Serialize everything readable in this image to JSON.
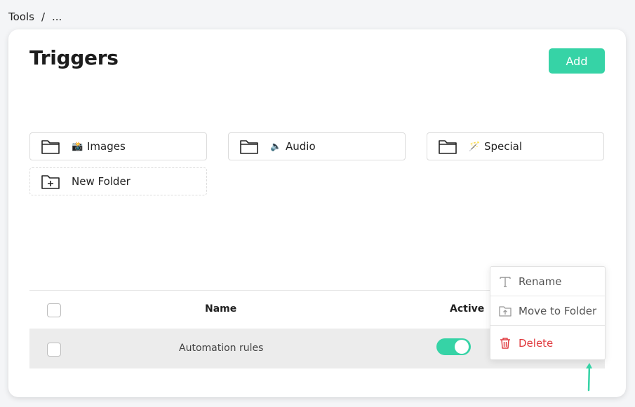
{
  "breadcrumb": {
    "root": "Tools",
    "separator": "/",
    "current": "..."
  },
  "page": {
    "title": "Triggers",
    "add_label": "Add"
  },
  "folders": [
    {
      "emoji": "📸",
      "label": "Images"
    },
    {
      "emoji": "🔈",
      "label": "Audio"
    },
    {
      "emoji": "🪄",
      "label": "Special"
    }
  ],
  "new_folder": {
    "label": "New Folder"
  },
  "table": {
    "columns": {
      "name": "Name",
      "active": "Active"
    },
    "rows": [
      {
        "name": "Automation rules",
        "active": true
      }
    ]
  },
  "context_menu": {
    "items": [
      {
        "label": "Rename",
        "icon": "text-icon"
      },
      {
        "label": "Move to Folder",
        "icon": "folder-move-icon"
      },
      {
        "label": "Delete",
        "icon": "trash-icon"
      }
    ]
  },
  "colors": {
    "accent": "#36d3a6",
    "danger": "#e0393e",
    "row_bg": "#ececec"
  }
}
